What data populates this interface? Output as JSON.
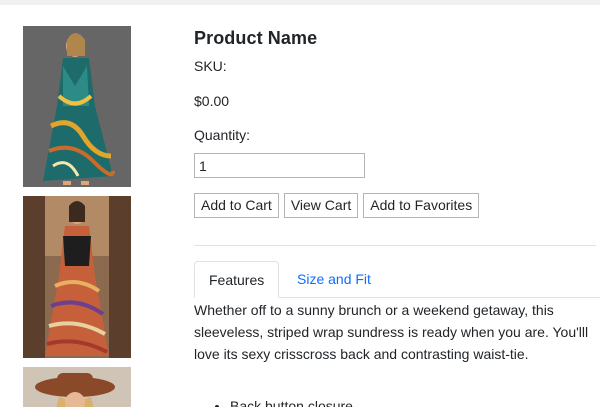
{
  "product": {
    "name": "Product Name",
    "sku_label": "SKU:",
    "price": "$0.00",
    "quantity_label": "Quantity:",
    "quantity_value": "1"
  },
  "buttons": {
    "add_to_cart": "Add to Cart",
    "view_cart": "View Cart",
    "add_to_favorites": "Add to Favorites"
  },
  "tabs": [
    {
      "label": "Features",
      "active": true
    },
    {
      "label": "Size and Fit",
      "active": false
    }
  ],
  "features": {
    "description": "Whether off to a sunny brunch or a weekend getaway, this sleeveless, striped wrap sundress is ready when you are. You'lll love its sexy crisscross back and contrasting waist-tie.",
    "bullets": [
      "Back button closure"
    ]
  },
  "colors": {
    "link": "#0d6efd",
    "text": "#212529",
    "border": "#b5b5b5"
  }
}
